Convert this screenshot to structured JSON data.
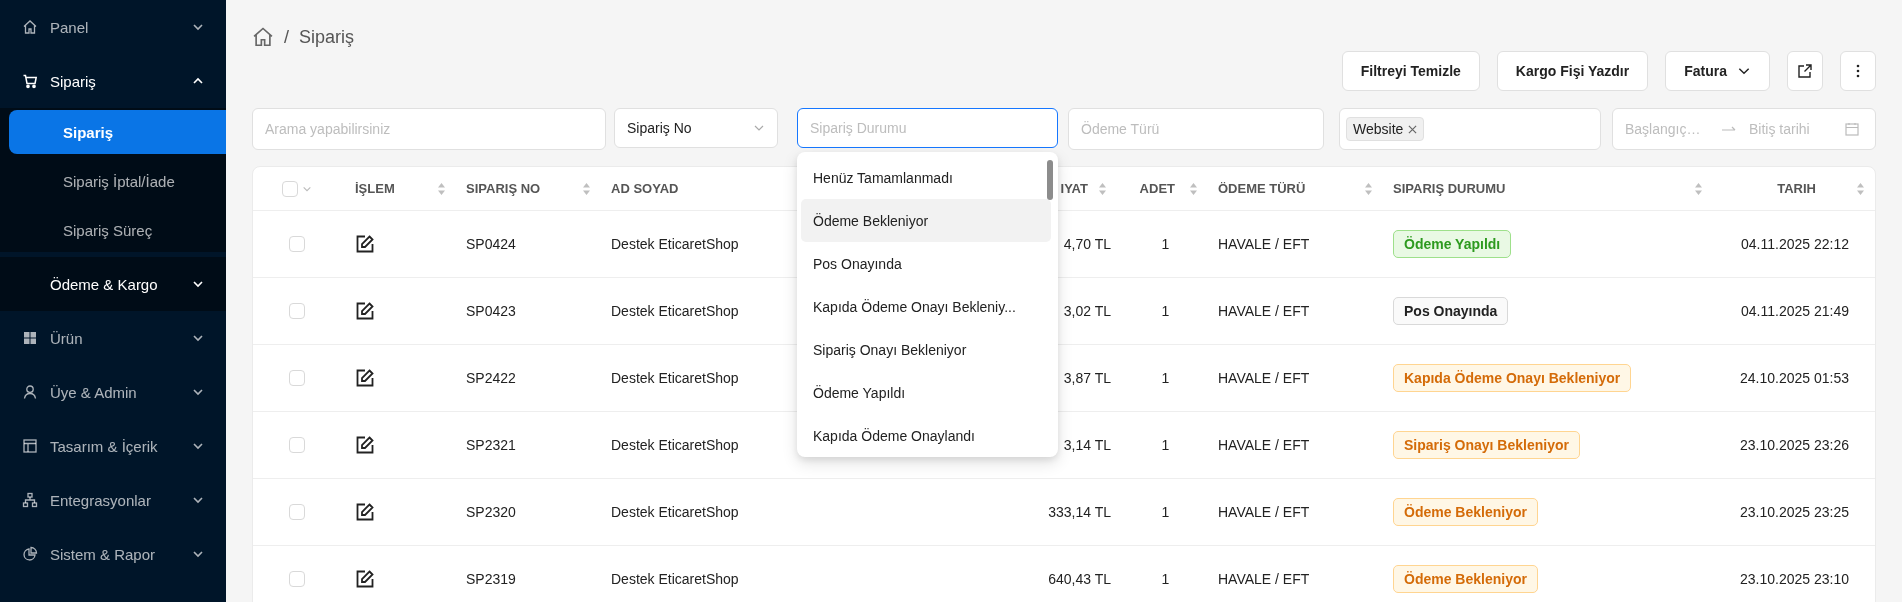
{
  "sidebar": {
    "items": [
      {
        "label": "Panel",
        "expanded": false,
        "hovered": false
      },
      {
        "label": "Sipariş",
        "expanded": true,
        "hovered": false,
        "children": [
          {
            "label": "Sipariş",
            "selected": true
          },
          {
            "label": "Sipariş İptal/İade",
            "selected": false
          },
          {
            "label": "Sipariş Süreç",
            "selected": false
          }
        ]
      },
      {
        "label": "Ödeme & Kargo",
        "expanded": false,
        "hovered": true
      },
      {
        "label": "Ürün",
        "expanded": false,
        "hovered": false
      },
      {
        "label": "Üye & Admin",
        "expanded": false,
        "hovered": false
      },
      {
        "label": "Tasarım & İçerik",
        "expanded": false,
        "hovered": false
      },
      {
        "label": "Entegrasyonlar",
        "expanded": false,
        "hovered": false
      },
      {
        "label": "Sistem & Rapor",
        "expanded": false,
        "hovered": false
      }
    ]
  },
  "breadcrumb": {
    "separator": "/",
    "current": "Sipariş"
  },
  "toolbar": {
    "buttons": [
      "Filtreyi Temizle",
      "Kargo Fişi Yazdır"
    ],
    "dropdown_button": "Fatura"
  },
  "filters": {
    "search": {
      "placeholder": "Arama yapabilirsiniz"
    },
    "search_by": {
      "value": "Sipariş No"
    },
    "order_status": {
      "placeholder": "Sipariş Durumu",
      "focused": true,
      "options": [
        {
          "label": "Henüz Tamamlanmadı",
          "highlighted": false
        },
        {
          "label": "Ödeme Bekleniyor",
          "highlighted": true
        },
        {
          "label": "Pos Onayında",
          "highlighted": false
        },
        {
          "label": "Kapıda Ödeme Onayı Bekleniy...",
          "highlighted": false
        },
        {
          "label": "Sipariş Onayı Bekleniyor",
          "highlighted": false
        },
        {
          "label": "Ödeme Yapıldı",
          "highlighted": false
        },
        {
          "label": "Kapıda Ödeme Onaylandı",
          "highlighted": false
        }
      ]
    },
    "payment_type": {
      "placeholder": "Ödeme Türü"
    },
    "channel": {
      "tags": [
        "Website"
      ]
    },
    "date_range": {
      "start_placeholder": "Başlangıç…",
      "end_placeholder": "Bitiş tarihi"
    }
  },
  "table": {
    "select_all_checked": false,
    "columns": [
      "İŞLEM",
      "SIPARIŞ NO",
      "AD SOYAD",
      "IYAT",
      "ADET",
      "ÖDEME TÜRÜ",
      "SIPARIŞ DURUMU",
      "TARIH"
    ],
    "rows": [
      {
        "checked": false,
        "order_no": "SP0424",
        "name": "Destek EticaretShop",
        "price": "4,70 TL",
        "qty": "1",
        "payment": "HAVALE / EFT",
        "status": "Ödeme Yapıldı",
        "kind": "success",
        "date": "04.11.2025 22:12"
      },
      {
        "checked": false,
        "order_no": "SP0423",
        "name": "Destek EticaretShop",
        "price": "3,02 TL",
        "qty": "1",
        "payment": "HAVALE / EFT",
        "status": "Pos Onayında",
        "kind": "default",
        "date": "04.11.2025 21:49"
      },
      {
        "checked": false,
        "order_no": "SP2422",
        "name": "Destek EticaretShop",
        "price": "3,87 TL",
        "qty": "1",
        "payment": "HAVALE / EFT",
        "status": "Kapıda Ödeme Onayı Bekleniyor",
        "kind": "warning",
        "date": "24.10.2025 01:53"
      },
      {
        "checked": false,
        "order_no": "SP2321",
        "name": "Destek EticaretShop",
        "price": "3,14 TL",
        "qty": "1",
        "payment": "HAVALE / EFT",
        "status": "Sipariş Onayı Bekleniyor",
        "kind": "warning",
        "date": "23.10.2025 23:26"
      },
      {
        "checked": false,
        "order_no": "SP2320",
        "name": "Destek EticaretShop",
        "price": "333,14 TL",
        "qty": "1",
        "payment": "HAVALE / EFT",
        "status": "Ödeme Bekleniyor",
        "kind": "warning",
        "date": "23.10.2025 23:25"
      },
      {
        "checked": false,
        "order_no": "SP2319",
        "name": "Destek EticaretShop",
        "price": "640,43 TL",
        "qty": "1",
        "payment": "HAVALE / EFT",
        "status": "Ödeme Bekleniyor",
        "kind": "warning",
        "date": "23.10.2025 23:10"
      }
    ]
  }
}
